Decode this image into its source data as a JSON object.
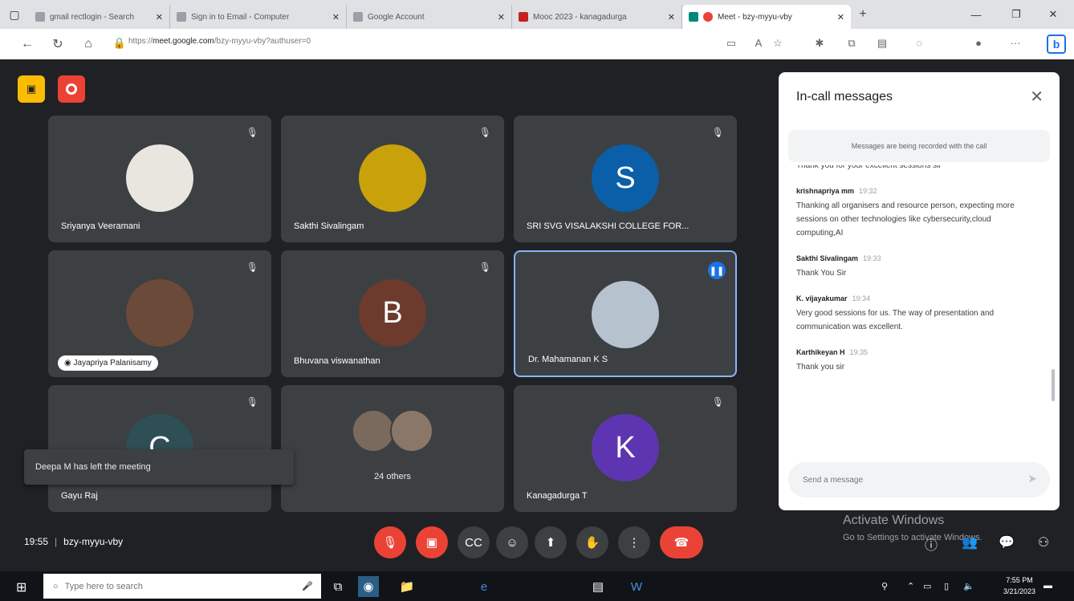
{
  "browser": {
    "tabs": [
      {
        "label": "gmail rectlogin - Search"
      },
      {
        "label": "Sign in to Email - Computer"
      },
      {
        "label": "Google Account"
      },
      {
        "label": "Mooc 2023 - kanagadurga"
      },
      {
        "label": "Meet - bzy-myyu-vby",
        "active": true
      }
    ],
    "url_prefix": "https://",
    "url_host": "meet.google.com",
    "url_path": "/bzy-myyu-vby?authuser=0"
  },
  "meet": {
    "tiles": [
      {
        "name": "Sriyanya Veeramani",
        "avatar_text": "",
        "avatar_color": "#e8e6df"
      },
      {
        "name": "Sakthi Sivalingam",
        "avatar_text": "",
        "avatar_color": "#c9a20b"
      },
      {
        "name": "SRI SVG VISALAKSHI COLLEGE FOR...",
        "avatar_text": "S",
        "avatar_color": "#0b5ea8"
      },
      {
        "name": "Jayapriya Palanisamy",
        "avatar_text": "",
        "avatar_color": "#6b4a3a"
      },
      {
        "name": "Bhuvana viswanathan",
        "avatar_text": "B",
        "avatar_color": "#6d3a2e"
      },
      {
        "name": "Dr. Mahamanan K S",
        "avatar_text": "",
        "avatar_color": "#b7c2cf"
      },
      {
        "name": "Gayu Raj",
        "avatar_text": "C",
        "avatar_color": "#2f4f56"
      },
      {
        "name": "24 others",
        "avatar_text": "",
        "avatar_color": "#5a5e63"
      },
      {
        "name": "Kanagadurga T",
        "avatar_text": "K",
        "avatar_color": "#5e35b1"
      }
    ],
    "toast": "Deepa M has left the meeting",
    "time": "19:55",
    "meeting_code": "bzy-myyu-vby"
  },
  "chat": {
    "title": "In-call messages",
    "notice": "Messages are being recorded with the call",
    "messages": [
      {
        "sender": "",
        "time": "",
        "text": "Thank you for your excellent sessions sir"
      },
      {
        "sender": "krishnapriya mm",
        "time": "19:32",
        "text": "Thanking all organisers and resource person, expecting more sessions on other technologies like cybersecurity,cloud computing,AI"
      },
      {
        "sender": "Sakthi Sivalingam",
        "time": "19:33",
        "text": "Thank You Sir"
      },
      {
        "sender": "K. vijayakumar",
        "time": "19:34",
        "text": "Very good sessions for us. The way of presentation and communication was excellent."
      },
      {
        "sender": "Karthikeyan H",
        "time": "19:35",
        "text": "Thank you sir"
      }
    ],
    "compose_placeholder": "Send a message"
  },
  "watermark": {
    "line1": "Activate Windows",
    "line2": "Go to Settings to activate Windows."
  },
  "taskbar": {
    "search_placeholder": "Type here to search",
    "time": "7:55 PM",
    "date": "3/21/2023"
  }
}
